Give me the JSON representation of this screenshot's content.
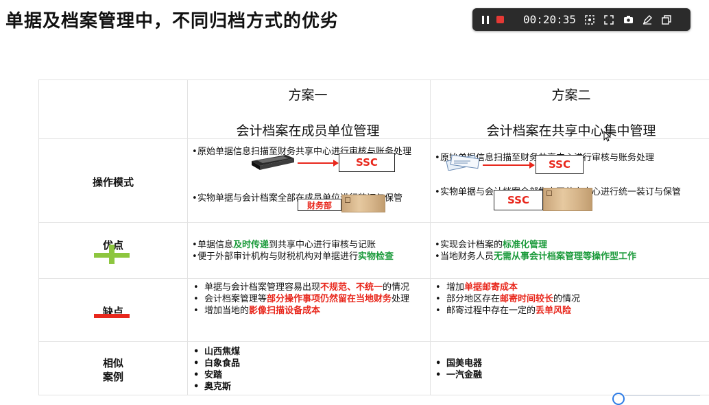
{
  "slide": {
    "title": "单据及档案管理中，不同归档方式的优劣"
  },
  "recorder": {
    "time": "00:20:35",
    "tools": [
      "pause-icon",
      "stop-icon",
      "screenshot-icon",
      "fullscreen-icon",
      "camera-icon",
      "pen-icon",
      "window-icon"
    ]
  },
  "table": {
    "plan1": {
      "name": "方案一",
      "subtitle": "会计档案在成员单位管理"
    },
    "plan2": {
      "name": "方案二",
      "subtitle": "会计档案在共享中心集中管理"
    },
    "rows": {
      "operation": {
        "label": "操作模式",
        "plan1": {
          "item1": "原始单据信息扫描至财务共享中心进行审核与账务处理",
          "item2": "实物单据与会计档案全部在成员单位进行装订与保管",
          "ssc": "SSC",
          "finance": "财务部"
        },
        "plan2": {
          "item1": "原始单据信息扫描至财务共享中心进行审核与账务处理",
          "item2": "实物单据与会计档案全部集中至共享中心进行统一装订与保管",
          "ssc_top": "SSC",
          "ssc_bottom": "SSC"
        }
      },
      "pros": {
        "label": "优点",
        "plan1": {
          "l1_a": "单据信息",
          "l1_b": "及时传递",
          "l1_c": "到共享中心进行审核与记账",
          "l2_a": "便于外部审计机构与财税机构对单据进行",
          "l2_b": "实物检查"
        },
        "plan2": {
          "l1_a": "实现会计档案的",
          "l1_b": "标准化管理",
          "l2_a": "当地财务人员",
          "l2_b": "无需从事会计档案管理等操作型工作"
        }
      },
      "cons": {
        "label": "缺点",
        "plan1": {
          "l1_a": "单据与会计档案管理容易出现",
          "l1_b": "不规范、不统一",
          "l1_c": "的情况",
          "l2_a": "会计档案管理等",
          "l2_b": "部分操作事项仍然留在当地财务",
          "l2_c": "处理",
          "l3_a": "增加当地的",
          "l3_b": "影像扫描设备成本"
        },
        "plan2": {
          "l1_a": "增加",
          "l1_b": "单据邮寄成本",
          "l2_a": "部分地区存在",
          "l2_b": "邮寄时间较长",
          "l2_c": "的情况",
          "l3_a": "邮寄过程中存在一定的",
          "l3_b": "丢单风险"
        }
      },
      "cases": {
        "label_1": "相似",
        "label_2": "案例",
        "plan1": [
          "山西焦煤",
          "白象食品",
          "安踏",
          "奥克斯"
        ],
        "plan2": [
          "国美电器",
          "一汽金融"
        ]
      }
    }
  },
  "colors": {
    "accent_red": "#e8271c",
    "accent_green": "#1a9a3a",
    "plus_green": "#8dc63f",
    "recorder_bg": "#2b2b2b"
  }
}
